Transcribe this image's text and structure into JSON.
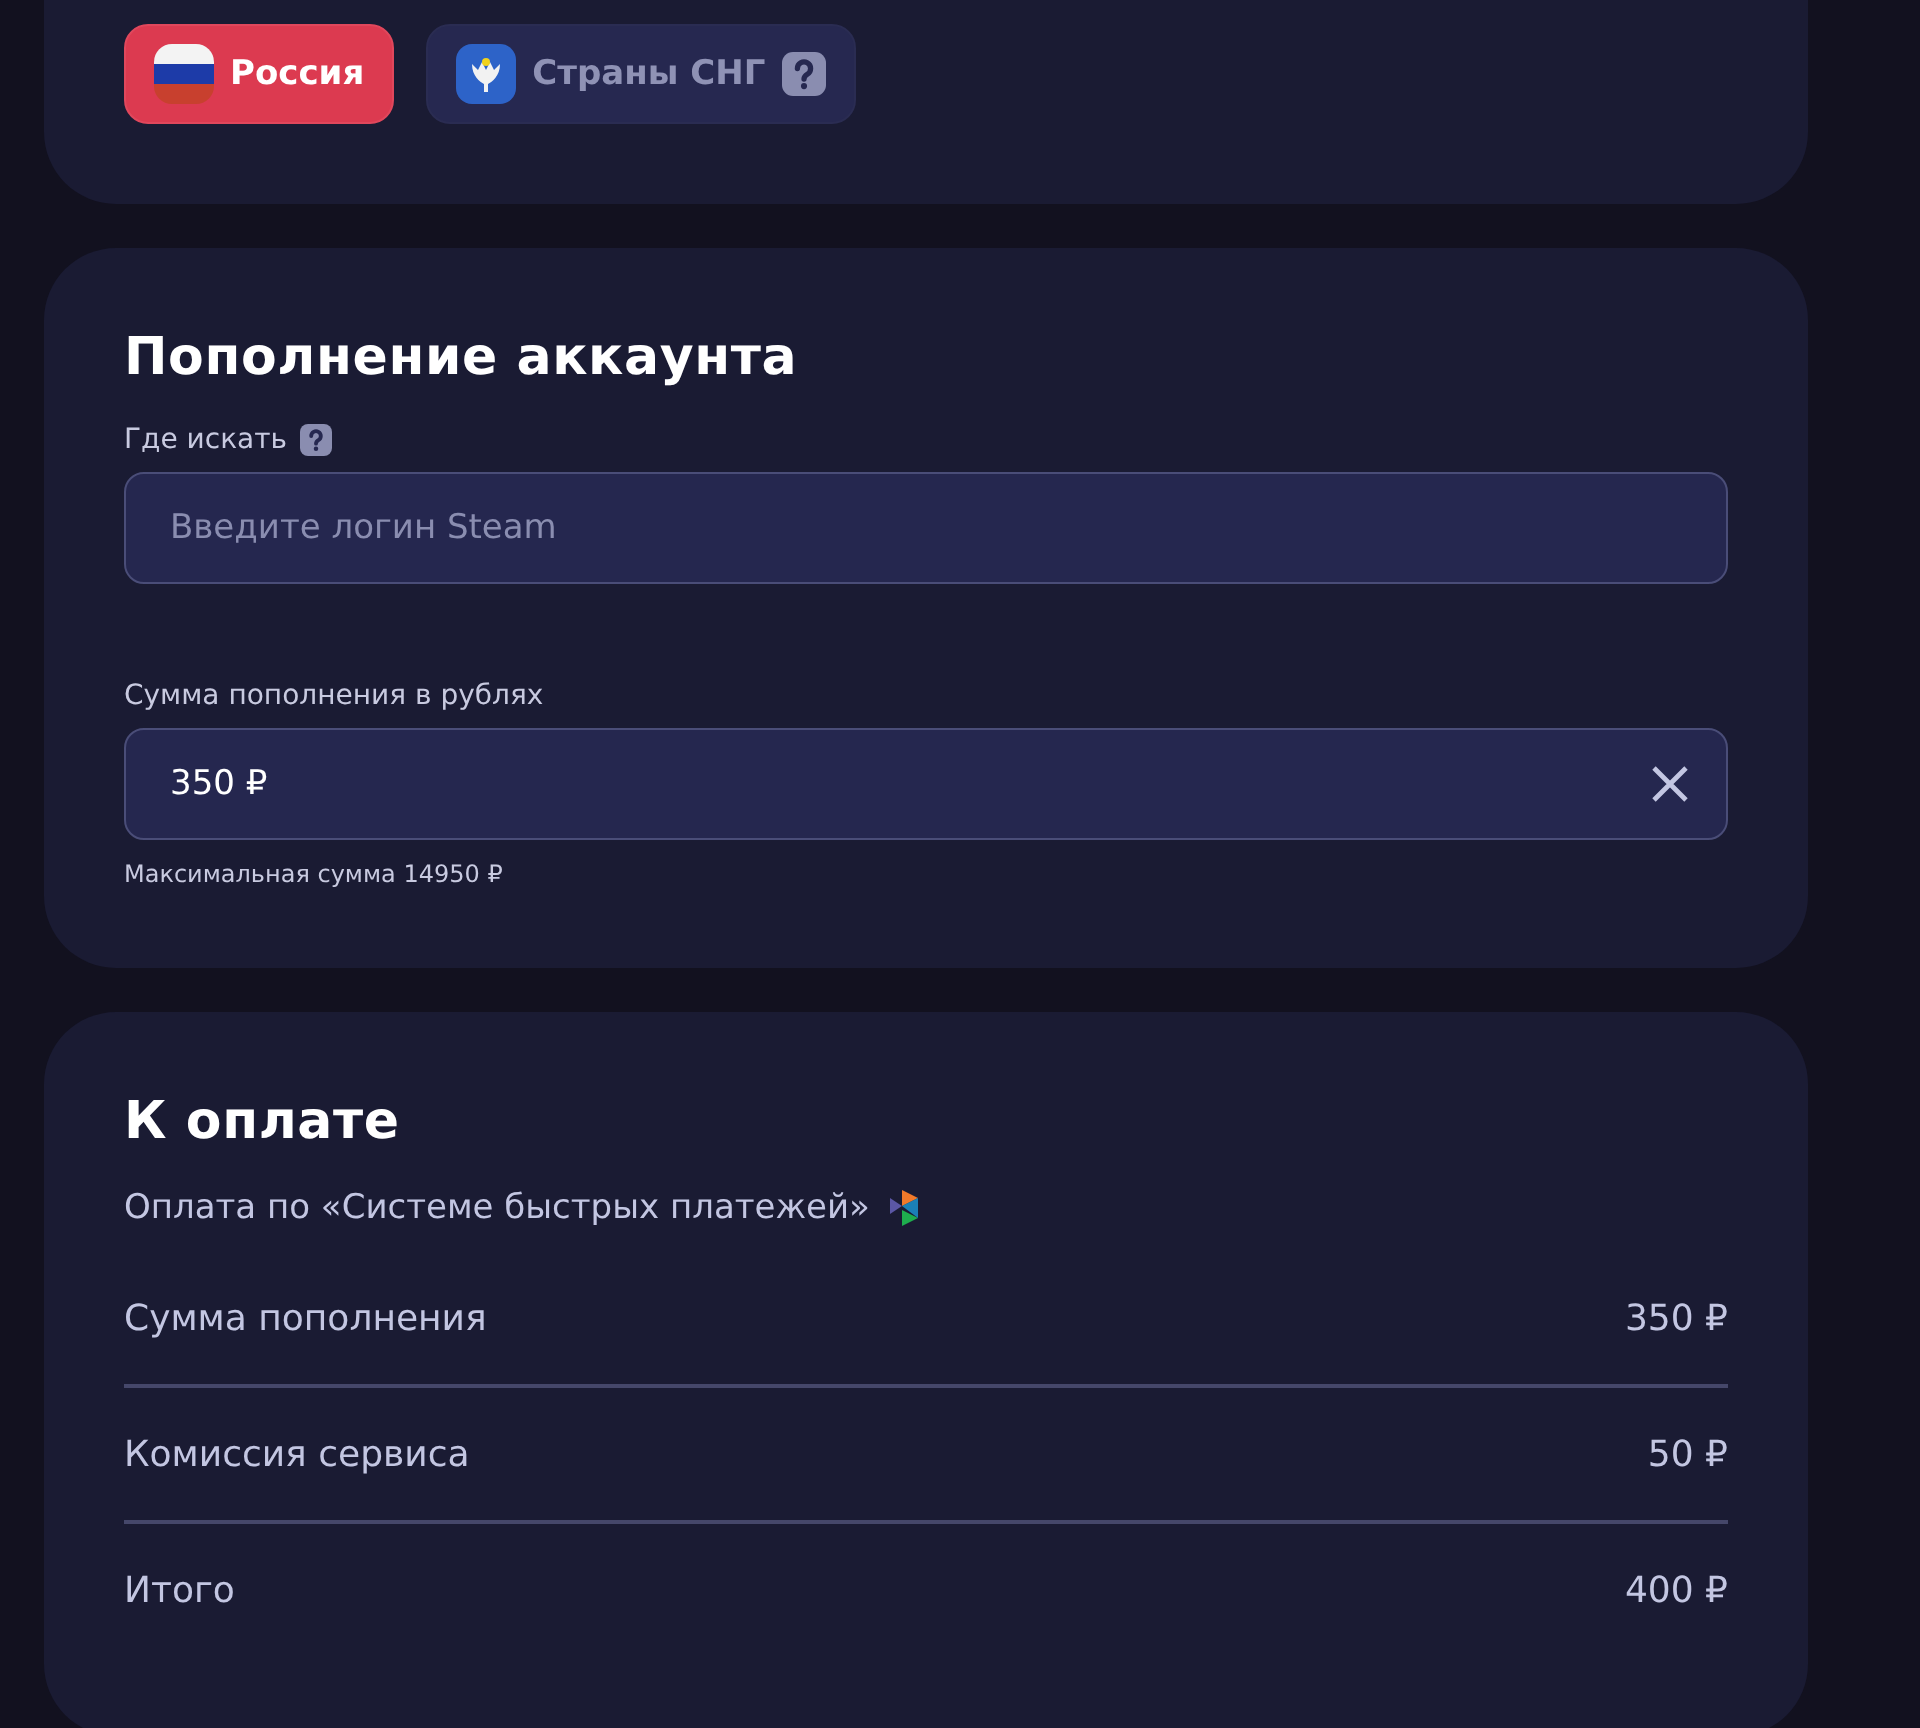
{
  "regions": [
    {
      "label": "Россия",
      "kind": "russia",
      "selected": true,
      "help": false
    },
    {
      "label": "Страны СНГ",
      "kind": "cis",
      "selected": false,
      "help": true
    }
  ],
  "topup": {
    "title": "Пополнение аккаунта",
    "login": {
      "label": "Где искать",
      "help": true,
      "placeholder": "Введите логин Steam"
    },
    "amount": {
      "label": "Сумма пополнения в рублях",
      "value": "350 ₽",
      "clearable": true,
      "hint": "Максимальная сумма 14950 ₽"
    }
  },
  "payment": {
    "title": "К оплате",
    "method": "Оплата по «Системе быстрых платежей»",
    "rows": [
      {
        "label": "Сумма пополнения",
        "value": "350 ₽"
      },
      {
        "label": "Комиссия сервиса",
        "value": "50 ₽"
      },
      {
        "label": "Итого",
        "value": "400 ₽"
      }
    ]
  }
}
